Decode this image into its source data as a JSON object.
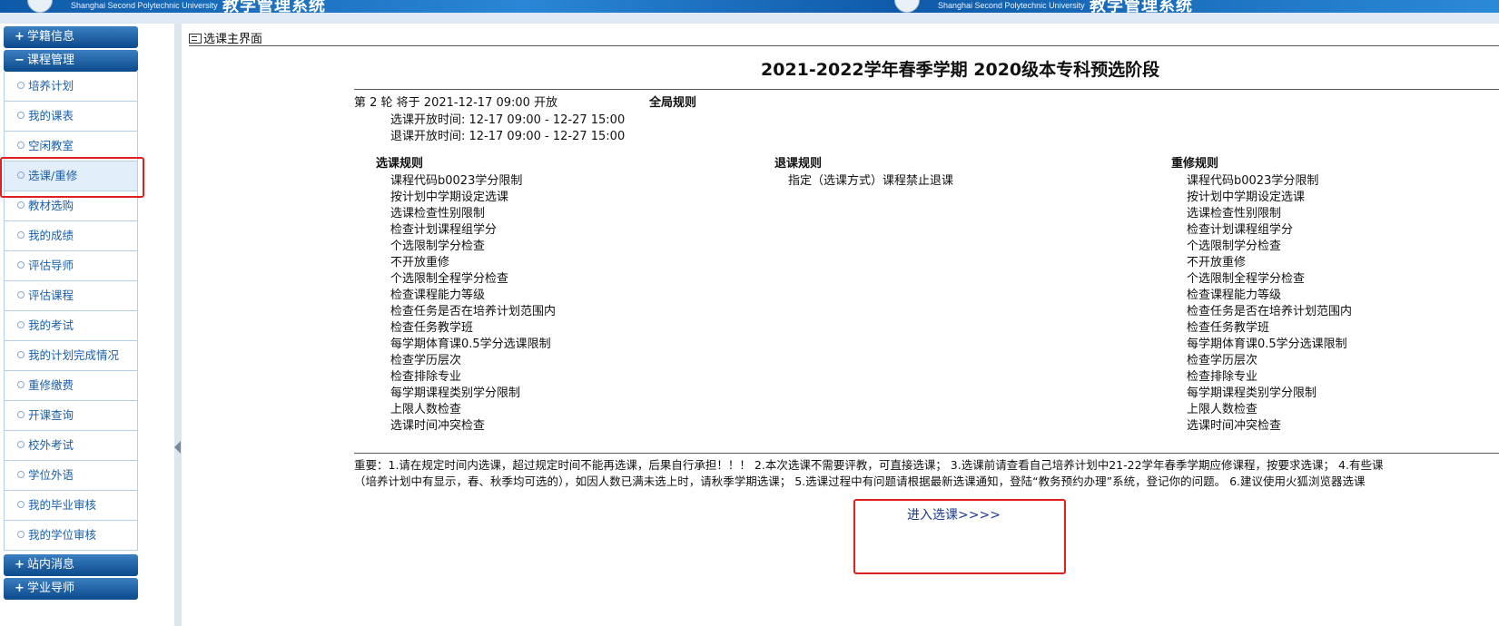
{
  "banner": {
    "university_en": "Shanghai Second Polytechnic University",
    "system_name_fragment": "教学管理系统"
  },
  "sidebar": {
    "sections": [
      {
        "symbol": "+",
        "label": "学籍信息"
      },
      {
        "symbol": "−",
        "label": "课程管理"
      },
      {
        "symbol": "+",
        "label": "站内消息"
      },
      {
        "symbol": "+",
        "label": "学业导师"
      }
    ],
    "course_items": [
      "培养计划",
      "我的课表",
      "空闲教室",
      "选课/重修",
      "教材选购",
      "我的成绩",
      "评估导师",
      "评估课程",
      "我的考试",
      "我的计划完成情况",
      "重修缴费",
      "开课查询",
      "校外考试",
      "学位外语",
      "我的毕业审核",
      "我的学位审核"
    ],
    "active_item": "选课/重修"
  },
  "main": {
    "frame_title": "选课主界面",
    "heading": "2021-2022学年春季学期 2020级本专科预选阶段",
    "round_line": "第 2 轮 将于 2021-12-17 09:00 开放",
    "select_time": "选课开放时间: 12-17 09:00 - 12-27 15:00",
    "drop_time": "退课开放时间: 12-17 09:00 - 12-27 15:00",
    "global_rules_title": "全局规则",
    "select_rules": {
      "title": "选课规则",
      "items": [
        "课程代码b0023学分限制",
        "按计划中学期设定选课",
        "选课检查性别限制",
        "检查计划课程组学分",
        "个选限制学分检查",
        "不开放重修",
        "个选限制全程学分检查",
        "检查课程能力等级",
        "检查任务是否在培养计划范围内",
        "检查任务教学班",
        "每学期体育课0.5学分选课限制",
        "检查学历层次",
        "检查排除专业",
        "每学期课程类别学分限制",
        "上限人数检查",
        "选课时间冲突检查"
      ]
    },
    "drop_rules": {
      "title": "退课规则",
      "items": [
        "指定（选课方式）课程禁止退课"
      ]
    },
    "retake_rules": {
      "title": "重修规则",
      "items": [
        "课程代码b0023学分限制",
        "按计划中学期设定选课",
        "选课检查性别限制",
        "检查计划课程组学分",
        "个选限制学分检查",
        "不开放重修",
        "个选限制全程学分检查",
        "检查课程能力等级",
        "检查任务是否在培养计划范围内",
        "检查任务教学班",
        "每学期体育课0.5学分选课限制",
        "检查学历层次",
        "检查排除专业",
        "每学期课程类别学分限制",
        "上限人数检查",
        "选课时间冲突检查"
      ]
    },
    "notice_line1": "重要：1.请在规定时间内选课，超过规定时间不能再选课，后果自行承担！！！ 2.本次选课不需要评教，可直接选课； 3.选课前请查看自己培养计划中21-22学年春季学期应修课程，按要求选课； 4.有些课",
    "notice_line2": "（培养计划中有显示，春、秋季均可选的），如因人数已满未选上时，请秋季学期选课； 5.选课过程中有问题请根据最新选课通知，登陆“教务预约办理”系统，登记你的问题。 6.建议使用火狐浏览器选课",
    "enter_link": "进入选课>>>>"
  },
  "colors": {
    "highlight": "#e0201f",
    "sidebar_header": "#0b4a8c",
    "link": "#1b3a8f"
  }
}
